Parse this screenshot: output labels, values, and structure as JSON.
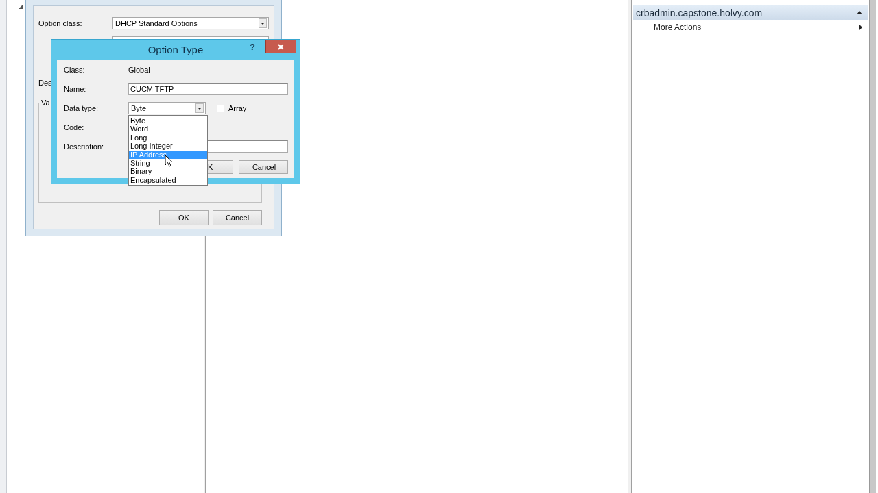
{
  "back_dialog": {
    "fields": [
      {
        "label": "Option class:",
        "value": "DHCP Standard Options"
      }
    ],
    "description_label": "Des",
    "group_label": "Va",
    "buttons": [
      "OK",
      "Cancel"
    ]
  },
  "dialog": {
    "title": "Option Type",
    "help": "?",
    "class_label": "Class:",
    "class_value": "Global",
    "name_label": "Name:",
    "name_value": "CUCM TFTP",
    "data_type_label": "Data type:",
    "data_type_value": "Byte",
    "array": {
      "label": "Array",
      "checked": false
    },
    "code_label": "Code:",
    "description_label": "Description:",
    "buttons": [
      "K",
      "Cancel"
    ],
    "dropdown": [
      {
        "label": "Byte",
        "selected": false
      },
      {
        "label": "Word",
        "selected": false
      },
      {
        "label": "Long",
        "selected": false
      },
      {
        "label": "Long Integer",
        "selected": false
      },
      {
        "label": "IP Address",
        "selected": true
      },
      {
        "label": "String",
        "selected": false
      },
      {
        "label": "Binary",
        "selected": false
      },
      {
        "label": "Encapsulated",
        "selected": false
      }
    ]
  },
  "actions": {
    "header": "crbadmin.capstone.holvy.com",
    "expanded": true,
    "items": [
      "More Actions"
    ]
  }
}
